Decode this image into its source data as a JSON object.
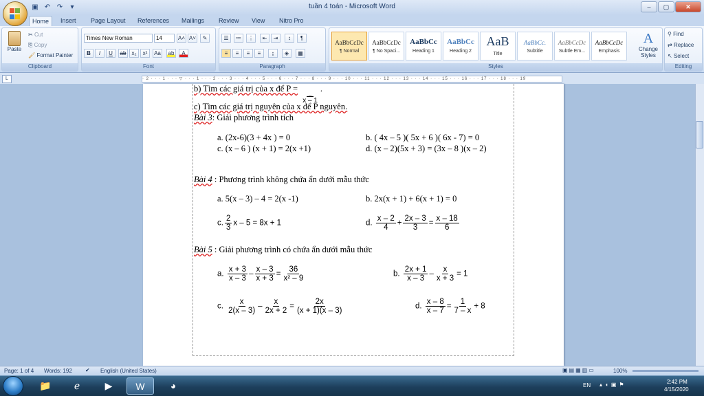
{
  "window": {
    "title": "tuần 4 toán - Microsoft Word",
    "controls": [
      "–",
      "▢",
      "✕"
    ]
  },
  "tabs": [
    "Home",
    "Insert",
    "Page Layout",
    "References",
    "Mailings",
    "Review",
    "View",
    "Nitro Pro"
  ],
  "ribbon": {
    "clipboard": {
      "label": "Clipboard",
      "paste": "Paste",
      "cut": "Cut",
      "copy": "Copy",
      "format_painter": "Format Painter"
    },
    "font": {
      "label": "Font",
      "family": "Times New Roman",
      "size": "14"
    },
    "paragraph": {
      "label": "Paragraph"
    },
    "styles": {
      "label": "Styles",
      "items": [
        {
          "preview": "AaBbCcDc",
          "name": "¶ Normal"
        },
        {
          "preview": "AaBbCcDc",
          "name": "¶ No Spaci..."
        },
        {
          "preview": "AaBbCc",
          "name": "Heading 1"
        },
        {
          "preview": "AaBbCc",
          "name": "Heading 2"
        },
        {
          "preview": "AaB",
          "name": "Title"
        },
        {
          "preview": "AaBbCc.",
          "name": "Subtitle"
        },
        {
          "preview": "AaBbCcDc",
          "name": "Subtle Em..."
        },
        {
          "preview": "AaBbCcDc",
          "name": "Emphasis"
        }
      ],
      "change_styles": "Change Styles"
    },
    "editing": {
      "label": "Editing",
      "find": "Find",
      "replace": "Replace",
      "select": "Select"
    }
  },
  "document": {
    "line_b": "b) Tìm các giá trị của x để P =",
    "line_b_frac": {
      "num": "3",
      "den": "x – 1"
    },
    "line_c": "c) Tìm các giá trị nguyên của x để P nguyên.",
    "bai3_title": "Bài 3",
    "bai3_text": ": Giải phương trình tích",
    "bai3_a": "a. (2x-6)(3 + 4x ) = 0",
    "bai3_b": "b. ( 4x – 5 )( 5x + 6 )( 6x - 7) = 0",
    "bai3_c": "c. (x – 6 ) (x + 1) = 2(x +1)",
    "bai3_d": "d. (x – 2)(5x + 3) = (3x – 8 )(x – 2)",
    "bai4_title": "Bài 4",
    "bai4_text": " : Phương trình không chứa ẩn dưới mẫu thức",
    "bai4_a": "a. 5(x – 3) – 4 = 2(x -1)",
    "bai4_b": "b. 2x(x + 1) + 6(x + 1) = 0",
    "bai4_c": {
      "prefix": "c.",
      "num": "2",
      "den": "3",
      "rest": "x – 5 = 8x + 1"
    },
    "bai4_d": {
      "prefix": "d.",
      "f1n": "x – 2",
      "f1d": "4",
      "op1": "+",
      "f2n": "2x – 3",
      "f2d": "3",
      "op2": "=",
      "f3n": "x – 18",
      "f3d": "6"
    },
    "bai5_title": "Bài 5",
    "bai5_text": " : Giải phương trình có chứa ẩn dưới mẫu thức",
    "bai5_a": {
      "prefix": "a.",
      "f1n": "x + 3",
      "f1d": "x – 3",
      "op1": "–",
      "f2n": "x – 3",
      "f2d": "x + 3",
      "op2": "=",
      "f3n": "36",
      "f3d": "x² – 9"
    },
    "bai5_b": {
      "prefix": "b.",
      "f1n": "2x + 1",
      "f1d": "x – 3",
      "op1": "–",
      "f2n": "x",
      "f2d": "x + 3",
      "rest": "= 1"
    },
    "bai5_c": {
      "prefix": "c.",
      "f1n": "x",
      "f1d": "2(x – 3)",
      "op1": "–",
      "f2n": "x",
      "f2d": "2x + 2",
      "op2": "=",
      "f3n": "2x",
      "f3d": "(x + 1)(x – 3)"
    },
    "bai5_d": {
      "prefix": "d.",
      "f1n": "x – 8",
      "f1d": "x – 7",
      "op1": "=",
      "f2n": "1",
      "f2d": "7 – x",
      "rest": "+ 8"
    }
  },
  "status": {
    "page": "Page: 1 of 4",
    "words": "Words: 192",
    "language": "English (United States)",
    "zoom": "100%"
  },
  "tray": {
    "lang": "EN",
    "time": "2:42 PM",
    "date": "4/15/2020"
  }
}
